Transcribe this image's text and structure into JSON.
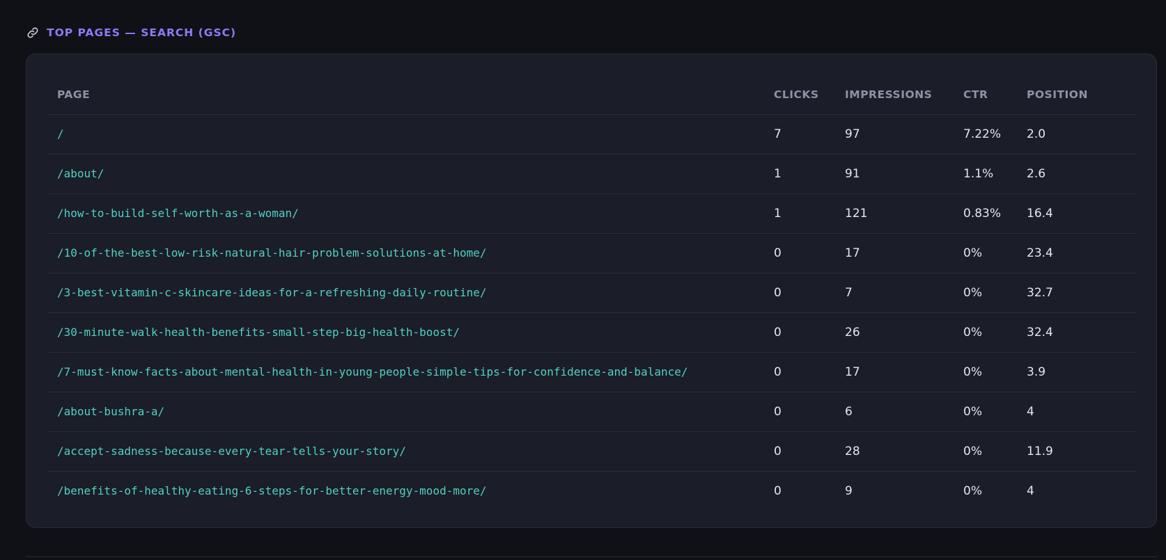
{
  "section": {
    "icon": "link-icon",
    "title": "TOP PAGES — SEARCH (GSC)"
  },
  "table": {
    "headers": {
      "page": "PAGE",
      "clicks": "CLICKS",
      "impressions": "IMPRESSIONS",
      "ctr": "CTR",
      "position": "POSITION"
    },
    "rows": [
      {
        "page": "/",
        "clicks": "7",
        "impressions": "97",
        "ctr": "7.22%",
        "position": "2.0"
      },
      {
        "page": "/about/",
        "clicks": "1",
        "impressions": "91",
        "ctr": "1.1%",
        "position": "2.6"
      },
      {
        "page": "/how-to-build-self-worth-as-a-woman/",
        "clicks": "1",
        "impressions": "121",
        "ctr": "0.83%",
        "position": "16.4"
      },
      {
        "page": "/10-of-the-best-low-risk-natural-hair-problem-solutions-at-home/",
        "clicks": "0",
        "impressions": "17",
        "ctr": "0%",
        "position": "23.4"
      },
      {
        "page": "/3-best-vitamin-c-skincare-ideas-for-a-refreshing-daily-routine/",
        "clicks": "0",
        "impressions": "7",
        "ctr": "0%",
        "position": "32.7"
      },
      {
        "page": "/30-minute-walk-health-benefits-small-step-big-health-boost/",
        "clicks": "0",
        "impressions": "26",
        "ctr": "0%",
        "position": "32.4"
      },
      {
        "page": "/7-must-know-facts-about-mental-health-in-young-people-simple-tips-for-confidence-and-balance/",
        "clicks": "0",
        "impressions": "17",
        "ctr": "0%",
        "position": "3.9"
      },
      {
        "page": "/about-bushra-a/",
        "clicks": "0",
        "impressions": "6",
        "ctr": "0%",
        "position": "4"
      },
      {
        "page": "/accept-sadness-because-every-tear-tells-your-story/",
        "clicks": "0",
        "impressions": "28",
        "ctr": "0%",
        "position": "11.9"
      },
      {
        "page": "/benefits-of-healthy-eating-6-steps-for-better-energy-mood-more/",
        "clicks": "0",
        "impressions": "9",
        "ctr": "0%",
        "position": "4"
      }
    ]
  },
  "colors": {
    "background": "#0f1117",
    "card": "#1b1d28",
    "accent_title": "#8b7cf6",
    "link": "#4fd1c5",
    "header_text": "#8e92a6",
    "body_text": "#e6e7ee"
  }
}
